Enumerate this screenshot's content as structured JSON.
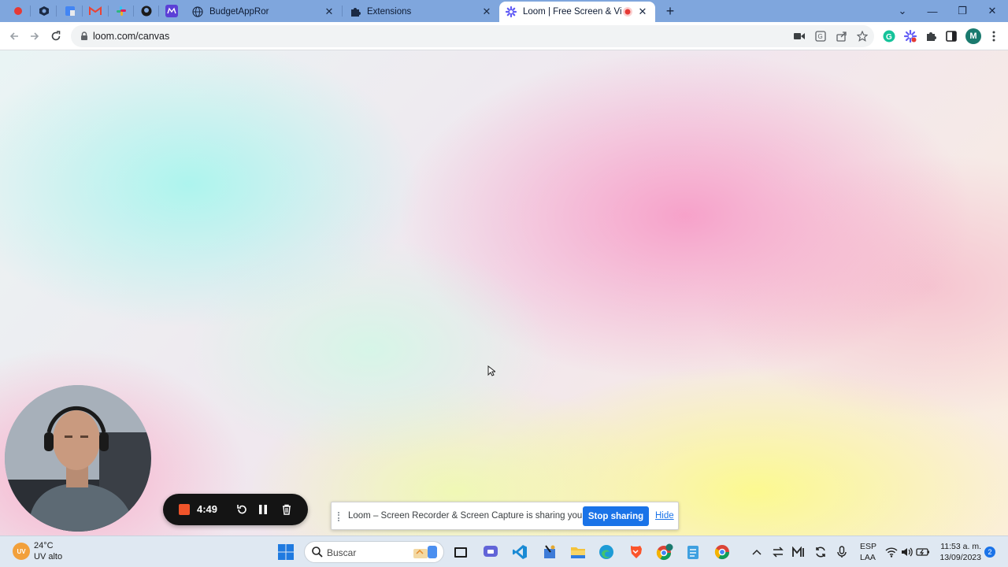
{
  "browser": {
    "tabs": [
      {
        "title": "BudgetAppRor",
        "close": "✕"
      },
      {
        "title": "Extensions",
        "close": "✕"
      },
      {
        "title": "Loom | Free Screen & Video",
        "close": "✕"
      }
    ],
    "new_tab": "+",
    "window_controls": {
      "chevron": "⌄",
      "minimize": "—",
      "restore": "❐",
      "close": "✕"
    },
    "url": "loom.com/canvas",
    "profile_initial": "M"
  },
  "loom": {
    "timer": "4:49",
    "share_message": "Loom – Screen Recorder & Screen Capture is sharing your screen.",
    "stop_sharing": "Stop sharing",
    "hide": "Hide"
  },
  "taskbar": {
    "weather_badge": "UV",
    "temperature": "24°C",
    "weather_desc": "UV alto",
    "search_placeholder": "Buscar",
    "language": "ESP",
    "layout": "LAA",
    "time": "11:53 a. m.",
    "date": "13/09/2023",
    "notifications": "2"
  },
  "colors": {
    "tabstrip": "#7fa6dd",
    "accent_blue": "#1a73e8",
    "rec_stop": "#f0542a",
    "recorder_bg": "#141414"
  }
}
